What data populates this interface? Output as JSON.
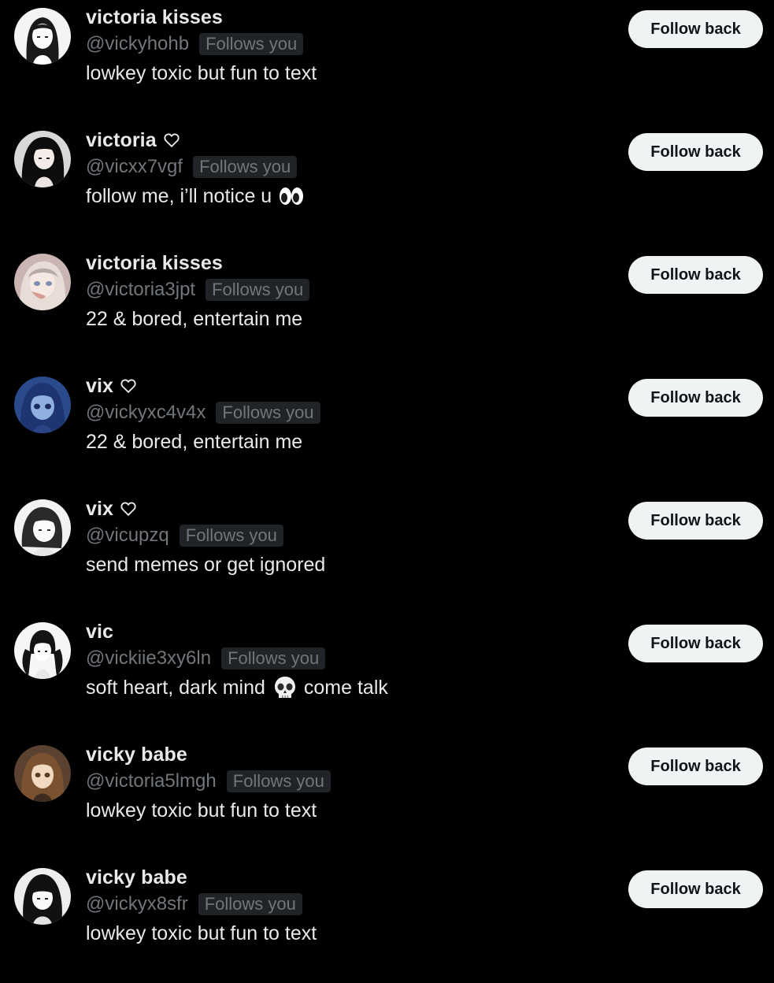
{
  "follow_button_label": "Follow back",
  "badge_label": "Follows you",
  "colors": {
    "background": "#000000",
    "name_text": "#e7e9ea",
    "secondary_text": "#71767b",
    "badge_background": "#202327",
    "button_background": "#eff3f4",
    "button_text": "#0f1419"
  },
  "users": [
    {
      "name": "victoria kisses",
      "has_heart": false,
      "handle": "@vickyhohb",
      "bio": "lowkey toxic but fun to text",
      "bio_parts": [
        "lowkey toxic but fun to text"
      ],
      "emoji": null,
      "avatar_icon": "anime-girl-monochrome-avatar"
    },
    {
      "name": "victoria",
      "has_heart": true,
      "handle": "@vicxx7vgf",
      "bio": "follow me, i’ll notice u",
      "bio_parts": [
        "follow me, i’ll notice u"
      ],
      "emoji": "eyes-emoji",
      "avatar_icon": "anime-girl-dark-hair-avatar"
    },
    {
      "name": "victoria kisses",
      "has_heart": false,
      "handle": "@victoria3jpt",
      "bio": "22 & bored, entertain me",
      "bio_parts": [
        "22 & bored, entertain me"
      ],
      "emoji": null,
      "avatar_icon": "anime-girl-pastel-avatar"
    },
    {
      "name": "vix",
      "has_heart": true,
      "handle": "@vickyxc4v4x",
      "bio": "22 & bored, entertain me",
      "bio_parts": [
        "22 & bored, entertain me"
      ],
      "emoji": null,
      "avatar_icon": "anime-girl-blue-avatar"
    },
    {
      "name": "vix",
      "has_heart": true,
      "handle": "@vicupzq",
      "bio": "send memes or get ignored",
      "bio_parts": [
        "send memes or get ignored"
      ],
      "emoji": null,
      "avatar_icon": "anime-girl-sketch-avatar"
    },
    {
      "name": "vic",
      "has_heart": false,
      "handle": "@vickiie3xy6ln",
      "bio": "soft heart, dark mind come talk",
      "bio_parts": [
        "soft heart, dark mind",
        "come talk"
      ],
      "emoji": "skull-emoji",
      "avatar_icon": "anime-girl-pigtails-avatar"
    },
    {
      "name": "vicky babe",
      "has_heart": false,
      "handle": "@victoria5lmgh",
      "bio": "lowkey toxic but fun to text",
      "bio_parts": [
        "lowkey toxic but fun to text"
      ],
      "emoji": null,
      "avatar_icon": "anime-girl-brown-hair-avatar"
    },
    {
      "name": "vicky babe",
      "has_heart": false,
      "handle": "@vickyx8sfr",
      "bio": "lowkey toxic but fun to text",
      "bio_parts": [
        "lowkey toxic but fun to text"
      ],
      "emoji": null,
      "avatar_icon": "anime-girl-bangs-avatar"
    }
  ]
}
